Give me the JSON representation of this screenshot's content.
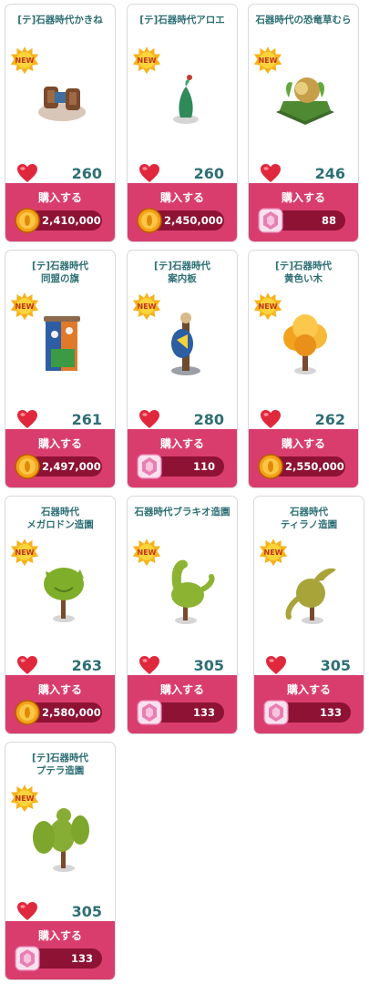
{
  "badge": {
    "new_label": "NEW"
  },
  "colors": {
    "accent": "#d93d6e",
    "price_bar": "#8d1234",
    "title": "#2e6f74",
    "heart": "#e0283d",
    "coin": "#f5a11a",
    "gem": "#e87fb2"
  },
  "items": [
    {
      "title": "[テ]石器時代かきね",
      "likes": "260",
      "buy_label": "購入する",
      "price": "2,410,000",
      "currency_icon": "coin-icon"
    },
    {
      "title": "[テ]石器時代アロエ",
      "likes": "260",
      "buy_label": "購入する",
      "price": "2,450,000",
      "currency_icon": "coin-icon"
    },
    {
      "title": "石器時代の恐竜草むら",
      "likes": "246",
      "buy_label": "購入する",
      "price": "88",
      "currency_icon": "gem-icon"
    },
    {
      "title": "[テ]石器時代\n同盟の旗",
      "likes": "261",
      "buy_label": "購入する",
      "price": "2,497,000",
      "currency_icon": "coin-icon"
    },
    {
      "title": "[テ]石器時代\n案内板",
      "likes": "280",
      "buy_label": "購入する",
      "price": "110",
      "currency_icon": "gem-icon"
    },
    {
      "title": "[テ]石器時代\n黄色い木",
      "likes": "262",
      "buy_label": "購入する",
      "price": "2,550,000",
      "currency_icon": "coin-icon"
    },
    {
      "title": "石器時代\nメガロドン造園",
      "likes": "263",
      "buy_label": "購入する",
      "price": "2,580,000",
      "currency_icon": "coin-icon"
    },
    {
      "title": "石器時代ブラキオ造園",
      "likes": "305",
      "buy_label": "購入する",
      "price": "133",
      "currency_icon": "gem-icon"
    },
    {
      "title": "石器時代\nティラノ造園",
      "likes": "305",
      "buy_label": "購入する",
      "price": "133",
      "currency_icon": "gem-icon"
    },
    {
      "title": "[テ]石器時代\nプテラ造園",
      "likes": "305",
      "buy_label": "購入する",
      "price": "133",
      "currency_icon": "gem-icon"
    }
  ]
}
